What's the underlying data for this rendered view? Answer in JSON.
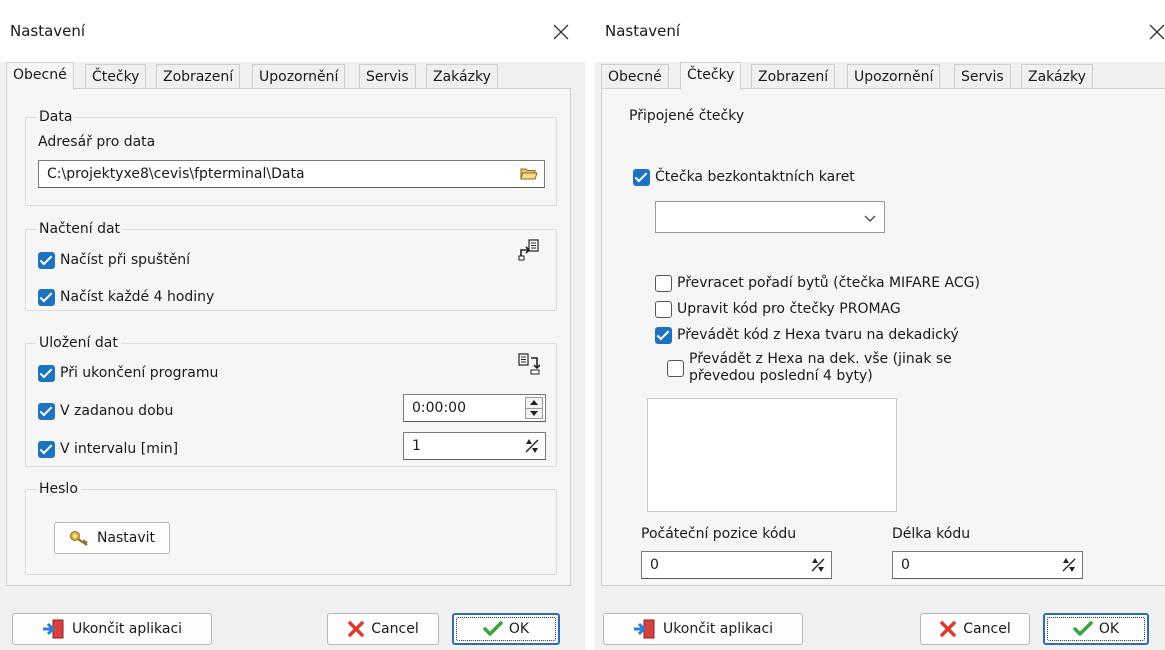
{
  "left": {
    "title": "Nastavení",
    "tabs": [
      "Obecné",
      "Čtečky",
      "Zobrazení",
      "Upozornění",
      "Servis",
      "Zakázky"
    ],
    "active_tab": "Obecné",
    "data_group": {
      "title": "Data",
      "dir_label": "Adresář pro data",
      "dir_value": "C:\\projektyxe8\\cevis\\fpterminal\\Data"
    },
    "load_group": {
      "title": "Načtení dat",
      "on_start": "Načíst při spuštění",
      "every_4h": "Načíst každé 4 hodiny"
    },
    "save_group": {
      "title": "Uložení dat",
      "on_exit": "Při ukončení programu",
      "at_time": "V zadanou dobu",
      "time_value": "0:00:00",
      "interval": "V intervalu [min]",
      "interval_value": "1"
    },
    "password_group": {
      "title": "Heslo",
      "set_button": "Nastavit"
    },
    "footer": {
      "exit_button": "Ukončit aplikaci",
      "cancel_button": "Cancel",
      "ok_button": "OK"
    }
  },
  "right": {
    "title": "Nastavení",
    "tabs": [
      "Obecné",
      "Čtečky",
      "Zobrazení",
      "Upozornění",
      "Servis",
      "Zakázky"
    ],
    "active_tab": "Čtečky",
    "section_label": "Připojené čtečky",
    "contactless": "Čtečka bezkontaktních karet",
    "reader_select_value": "",
    "options": {
      "reverse_bytes": "Převracet pořadí bytů (čtečka MIFARE ACG)",
      "promag": "Upravit kód pro čtečky PROMAG",
      "hex_to_dec": "Převádět kód z Hexa tvaru na dekadický",
      "hex_all_line1": "Převádět z Hexa na dek. vše (jinak se",
      "hex_all_line2": "převedou poslední 4 byty)"
    },
    "start_pos_label": "Počáteční pozice kódu",
    "start_pos_value": "0",
    "length_label": "Délka kódu",
    "length_value": "0",
    "footer": {
      "exit_button": "Ukončit aplikaci",
      "cancel_button": "Cancel",
      "ok_button": "OK"
    }
  },
  "colors": {
    "checkbox_checked": "#1e73be",
    "cancel_icon": "#e03a2f",
    "ok_icon": "#3aa53a",
    "default_button_border": "#2a6cb8"
  },
  "icons": {
    "folder": "folder-open-icon",
    "load": "load-data-icon",
    "save": "save-data-icon",
    "key": "key-icon",
    "exit": "exit-door-icon",
    "cancel": "cancel-x-icon",
    "ok": "checkmark-icon",
    "dropdown": "chevron-down-icon",
    "spin": "spin-arrows-icon"
  }
}
